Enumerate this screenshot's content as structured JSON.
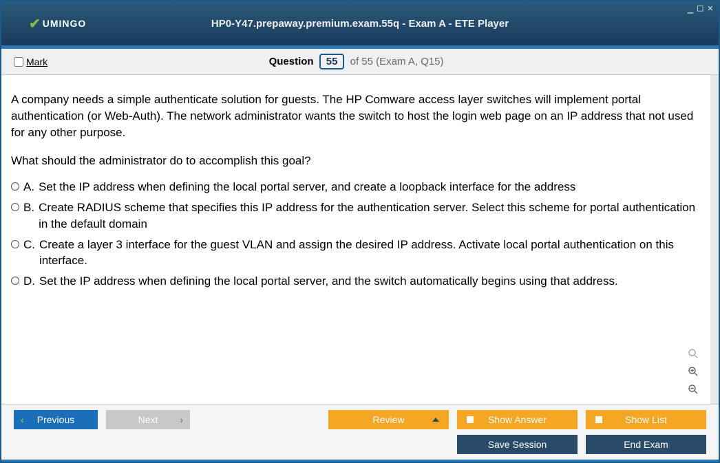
{
  "window": {
    "logo_text": "UMINGO",
    "title": "HP0-Y47.prepaway.premium.exam.55q - Exam A - ETE Player"
  },
  "question_bar": {
    "mark_label": "Mark",
    "question_label": "Question",
    "current_number": "55",
    "of_text": "of 55 (Exam A, Q15)"
  },
  "question": {
    "body": "A company needs a simple authenticate solution for guests. The HP Comware access layer switches will implement portal authentication (or Web-Auth). The network administrator wants the switch to host the login web page on an IP address that not used for any other purpose.",
    "ask": "What should the administrator do to accomplish this goal?",
    "answers": [
      {
        "letter": "A.",
        "text": "Set the IP address when defining the local portal server, and create a loopback interface for the address"
      },
      {
        "letter": "B.",
        "text": "Create RADIUS scheme that specifies this IP address for the authentication server. Select this scheme for portal authentication in the default domain"
      },
      {
        "letter": "C.",
        "text": "Create a layer 3 interface for the guest VLAN and assign the desired IP address. Activate local portal authentication on this interface."
      },
      {
        "letter": "D.",
        "text": "Set the IP address when defining the local portal server, and the switch automatically begins using that address."
      }
    ]
  },
  "footer": {
    "previous": "Previous",
    "next": "Next",
    "review": "Review",
    "show_answer": "Show Answer",
    "show_list": "Show List",
    "save_session": "Save Session",
    "end_exam": "End Exam"
  }
}
